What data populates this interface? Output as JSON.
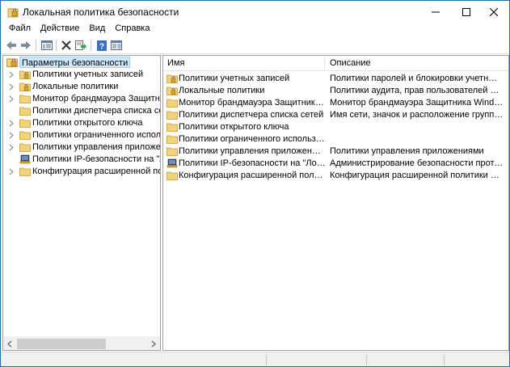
{
  "window": {
    "title": "Локальная политика безопасности",
    "title_icon": "security-policy-icon",
    "controls": [
      "minimize-icon",
      "maximize-icon",
      "close-icon"
    ]
  },
  "menu": {
    "items": [
      "Файл",
      "Действие",
      "Вид",
      "Справка"
    ]
  },
  "toolbar": {
    "buttons": [
      "back-arrow-icon",
      "forward-arrow-icon",
      "show-hide-tree-icon",
      "delete-icon",
      "export-list-icon",
      "help-icon",
      "properties-pane-icon"
    ]
  },
  "tree": {
    "root": {
      "label": "Параметры безопасности",
      "icon": "security-settings-icon"
    },
    "items": [
      {
        "label": "Политики учетных записей",
        "icon": "folder-lock-icon"
      },
      {
        "label": "Локальные политики",
        "icon": "folder-lock-icon"
      },
      {
        "label": "Монитор брандмауэра Защитника Windows в режиме повышенной безопасности",
        "icon": "folder-icon"
      },
      {
        "label": "Политики диспетчера списка сетей",
        "icon": "folder-icon"
      },
      {
        "label": "Политики открытого ключа",
        "icon": "folder-icon"
      },
      {
        "label": "Политики ограниченного использования программ",
        "icon": "folder-icon"
      },
      {
        "label": "Политики управления приложениями",
        "icon": "folder-icon"
      },
      {
        "label": "Политики IP-безопасности на \"Локальный компьютер\"",
        "icon": "ip-security-icon"
      },
      {
        "label": "Конфигурация расширенной политики аудита",
        "icon": "folder-icon"
      }
    ]
  },
  "list": {
    "columns": {
      "name": "Имя",
      "description": "Описание"
    },
    "rows": [
      {
        "name": "Политики учетных записей",
        "description": "Политики паролей и блокировки учетных записей",
        "icon": "folder-lock-icon"
      },
      {
        "name": "Локальные политики",
        "description": "Политики аудита, прав пользователей и параметров безопасности",
        "icon": "folder-lock-icon"
      },
      {
        "name": "Монитор брандмауэра Защитника Windows в режиме повышенной безопасности",
        "description": "Монитор брандмауэра Защитника Windows в режиме повышенной безопасности",
        "icon": "folder-icon"
      },
      {
        "name": "Политики диспетчера списка сетей",
        "description": "Имя сети, значок и расположение групповых политик",
        "icon": "folder-icon"
      },
      {
        "name": "Политики открытого ключа",
        "description": "",
        "icon": "folder-icon"
      },
      {
        "name": "Политики ограниченного использования программ",
        "description": "",
        "icon": "folder-icon"
      },
      {
        "name": "Политики управления приложениями",
        "description": "Политики управления приложениями",
        "icon": "folder-icon"
      },
      {
        "name": "Политики IP-безопасности на \"Локальный компьютер\"",
        "description": "Администрирование безопасности протокола IP",
        "icon": "ip-security-icon"
      },
      {
        "name": "Конфигурация расширенной политики аудита",
        "description": "Конфигурация расширенной политики аудита",
        "icon": "folder-icon"
      }
    ]
  },
  "colors": {
    "window_border": "#1e6fbf",
    "selection_bg": "#cce8ff",
    "selection_border": "#99d1ff",
    "folder": "#e8c46a",
    "status_bg": "#f0f0f0"
  }
}
